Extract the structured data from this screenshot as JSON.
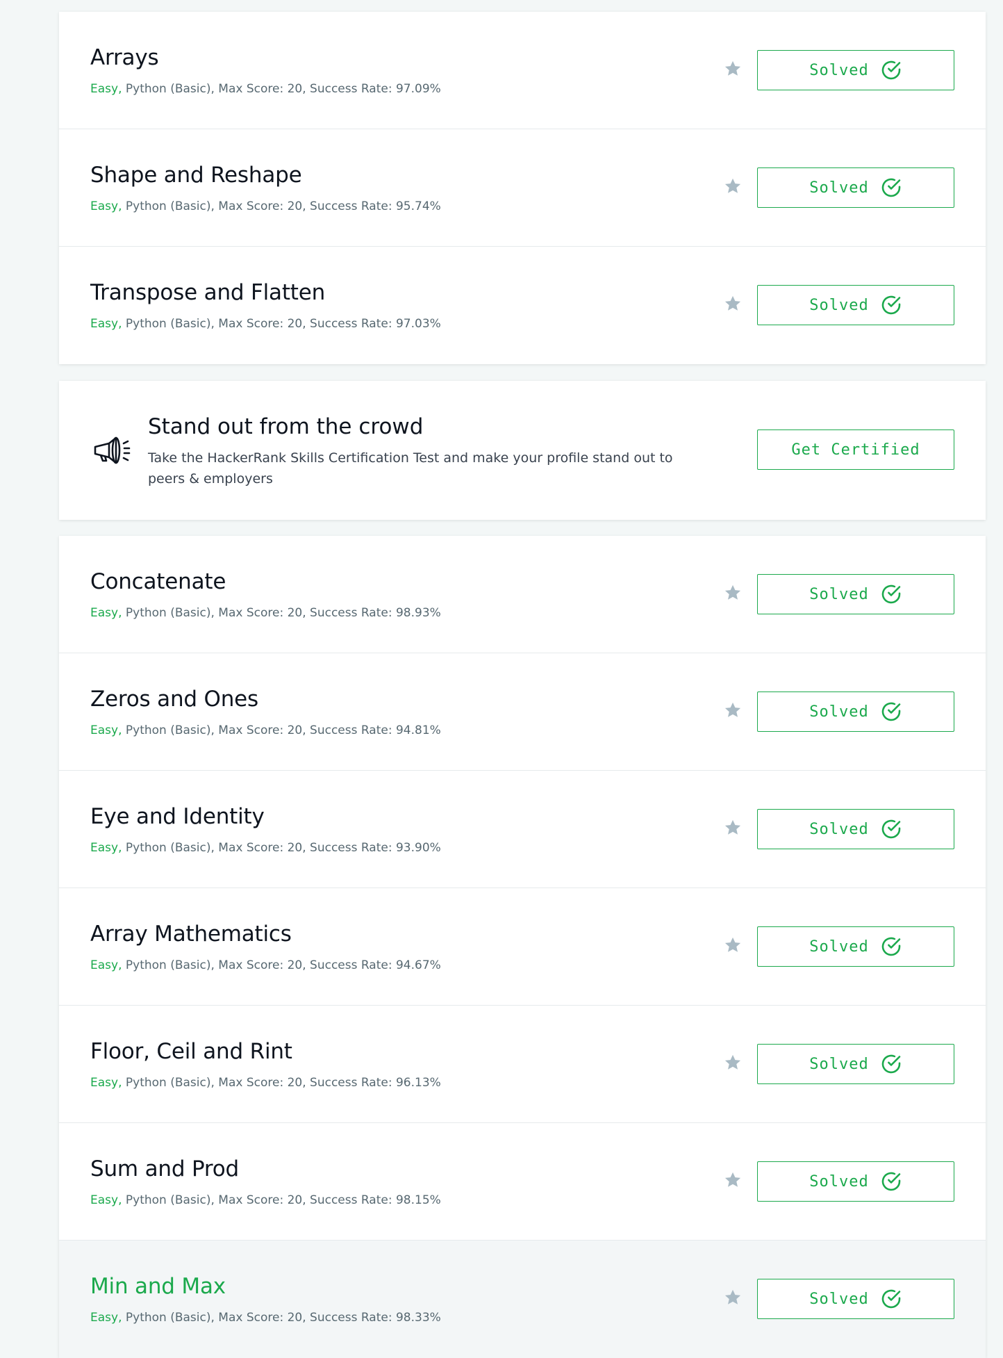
{
  "colors": {
    "accent": "#1ba94c",
    "title": "#0e141e",
    "meta": "#576871",
    "star": "#a9bac4",
    "page_bg": "#f3f7f7"
  },
  "group_one": [
    {
      "title": "Arrays",
      "difficulty": "Easy,",
      "details": "Python (Basic), Max Score: 20, Success Rate: 97.09%",
      "status": "Solved"
    },
    {
      "title": "Shape and Reshape",
      "difficulty": "Easy,",
      "details": "Python (Basic), Max Score: 20, Success Rate: 95.74%",
      "status": "Solved"
    },
    {
      "title": "Transpose and Flatten",
      "difficulty": "Easy,",
      "details": "Python (Basic), Max Score: 20, Success Rate: 97.03%",
      "status": "Solved"
    }
  ],
  "certification": {
    "icon": "megaphone-icon",
    "title": "Stand out from the crowd",
    "description": "Take the HackerRank Skills Certification Test and make your profile stand out to peers & employers",
    "button_label": "Get Certified"
  },
  "group_two": [
    {
      "title": "Concatenate",
      "difficulty": "Easy,",
      "details": "Python (Basic), Max Score: 20, Success Rate: 98.93%",
      "status": "Solved"
    },
    {
      "title": "Zeros and Ones",
      "difficulty": "Easy,",
      "details": "Python (Basic), Max Score: 20, Success Rate: 94.81%",
      "status": "Solved"
    },
    {
      "title": "Eye and Identity",
      "difficulty": "Easy,",
      "details": "Python (Basic), Max Score: 20, Success Rate: 93.90%",
      "status": "Solved"
    },
    {
      "title": "Array Mathematics",
      "difficulty": "Easy,",
      "details": "Python (Basic), Max Score: 20, Success Rate: 94.67%",
      "status": "Solved"
    },
    {
      "title": "Floor, Ceil and Rint",
      "difficulty": "Easy,",
      "details": "Python (Basic), Max Score: 20, Success Rate: 96.13%",
      "status": "Solved"
    },
    {
      "title": "Sum and Prod",
      "difficulty": "Easy,",
      "details": "Python (Basic), Max Score: 20, Success Rate: 98.15%",
      "status": "Solved"
    },
    {
      "title": "Min and Max",
      "difficulty": "Easy,",
      "details": "Python (Basic), Max Score: 20, Success Rate: 98.33%",
      "status": "Solved",
      "hovered": true
    }
  ]
}
